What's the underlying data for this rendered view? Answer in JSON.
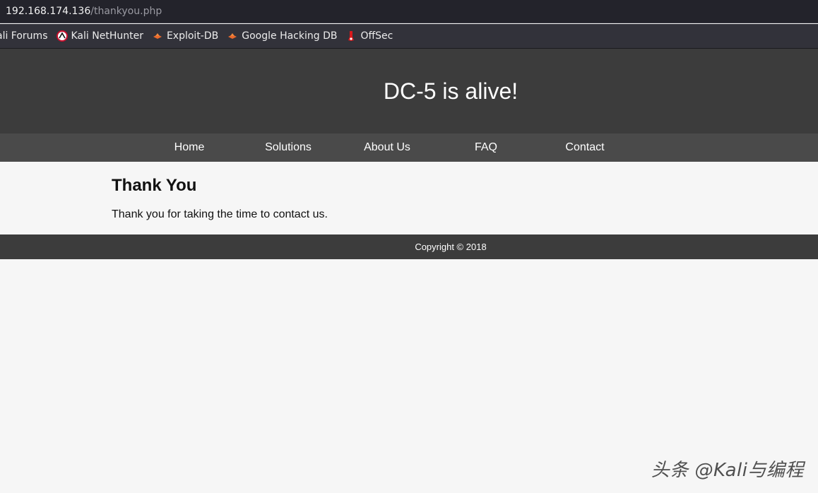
{
  "browser": {
    "url_host": "192.168.174.136",
    "url_path": "/thankyou.php",
    "bookmarks": [
      {
        "label": "ali Forums",
        "icon": "none"
      },
      {
        "label": "Kali NetHunter",
        "icon": "nethunter-icon"
      },
      {
        "label": "Exploit-DB",
        "icon": "exploit-db-icon"
      },
      {
        "label": "Google Hacking DB",
        "icon": "ghdb-icon"
      },
      {
        "label": "OffSec",
        "icon": "offsec-icon"
      }
    ]
  },
  "site": {
    "title": "DC-5 is alive!",
    "nav": [
      "Home",
      "Solutions",
      "About Us",
      "FAQ",
      "Contact"
    ],
    "heading": "Thank You",
    "message": "Thank you for taking the time to contact us.",
    "footer": "Copyright © 2018"
  },
  "watermark": "头条 @Kali与编程",
  "colors": {
    "header_bg": "#3c3c3c",
    "nav_bg": "#4a4a4a",
    "page_bg": "#f6f6f6"
  }
}
